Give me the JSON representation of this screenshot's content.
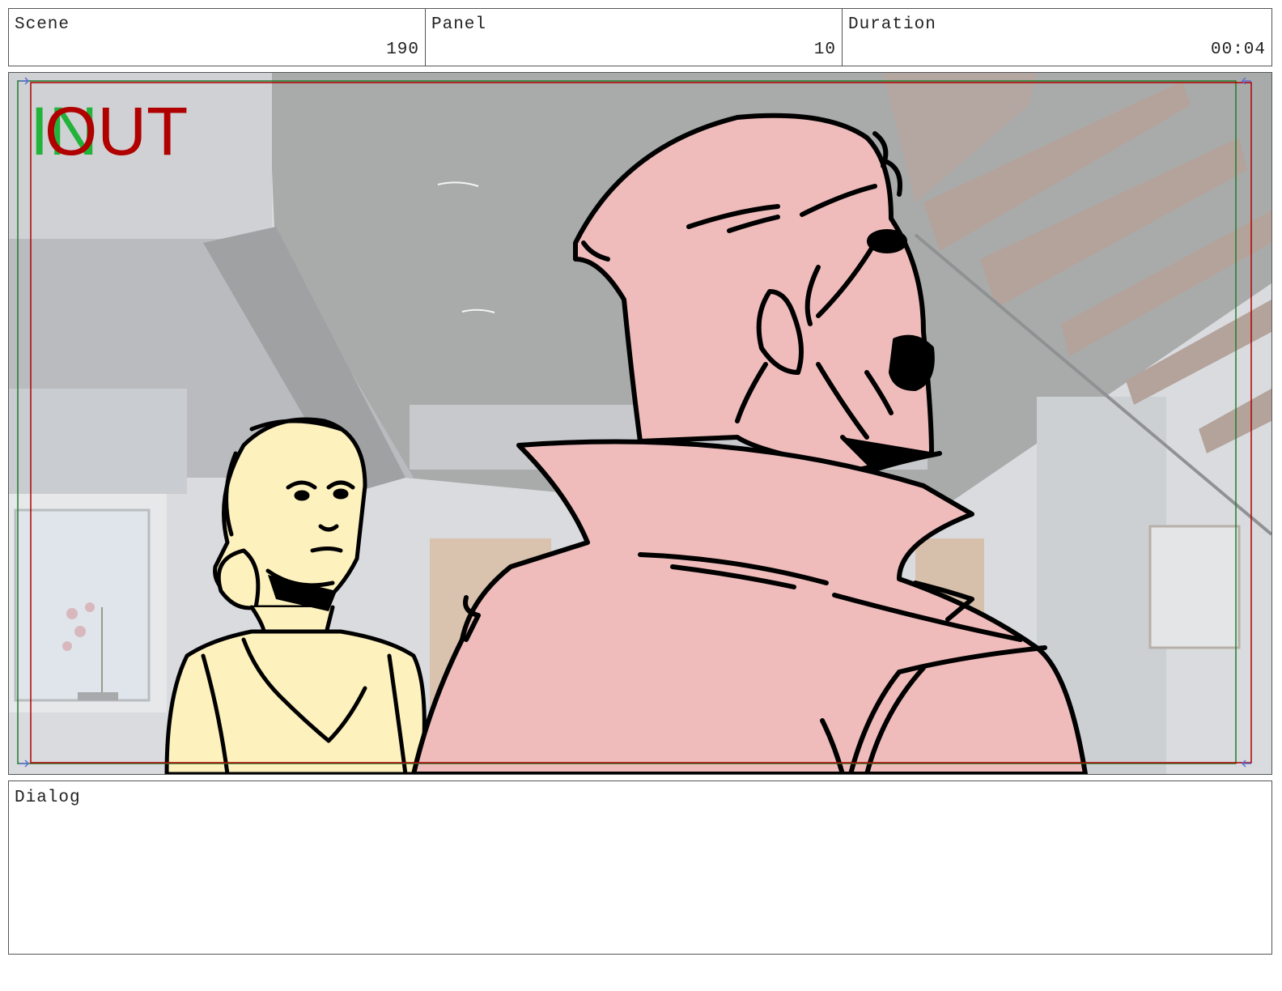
{
  "header": {
    "scene_label": "Scene",
    "scene_value": "190",
    "panel_label": "Panel",
    "panel_value": "10",
    "duration_label": "Duration",
    "duration_value": "00:04"
  },
  "frame": {
    "in_marker": "IN",
    "out_marker": "OUT",
    "colors": {
      "in_marker": "#22b33a",
      "out_marker": "#b00000",
      "safe_frame_red": "#b00000",
      "safe_frame_green": "#1f7a2a",
      "character_left_fill": "#fdf1bd",
      "character_right_fill": "#efbcbb"
    }
  },
  "dialog": {
    "label": "Dialog"
  }
}
